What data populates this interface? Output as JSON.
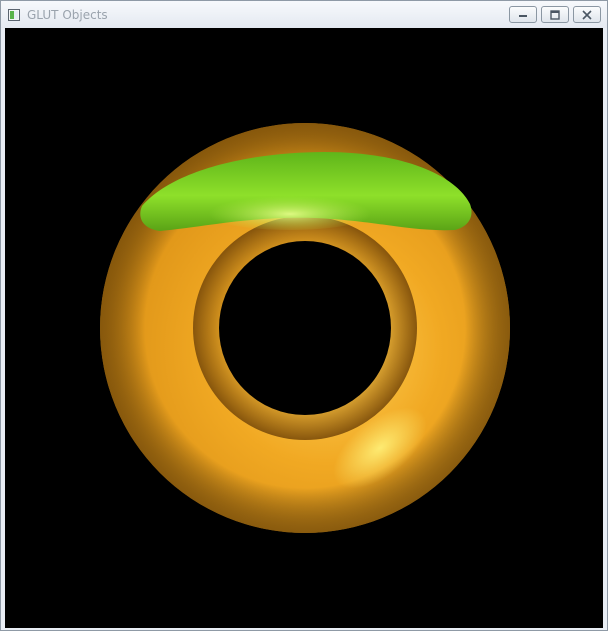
{
  "window": {
    "title": "GLUT Objects",
    "controls": {
      "minimize_icon": "minimize-icon",
      "restore_icon": "restore-icon",
      "close_icon": "close-icon"
    }
  },
  "scene": {
    "background_color": "#000000",
    "object": "torus",
    "torus_color": "#f0a321",
    "top_patch_color": "#7bd11b",
    "highlight_color": "#fff27a"
  }
}
